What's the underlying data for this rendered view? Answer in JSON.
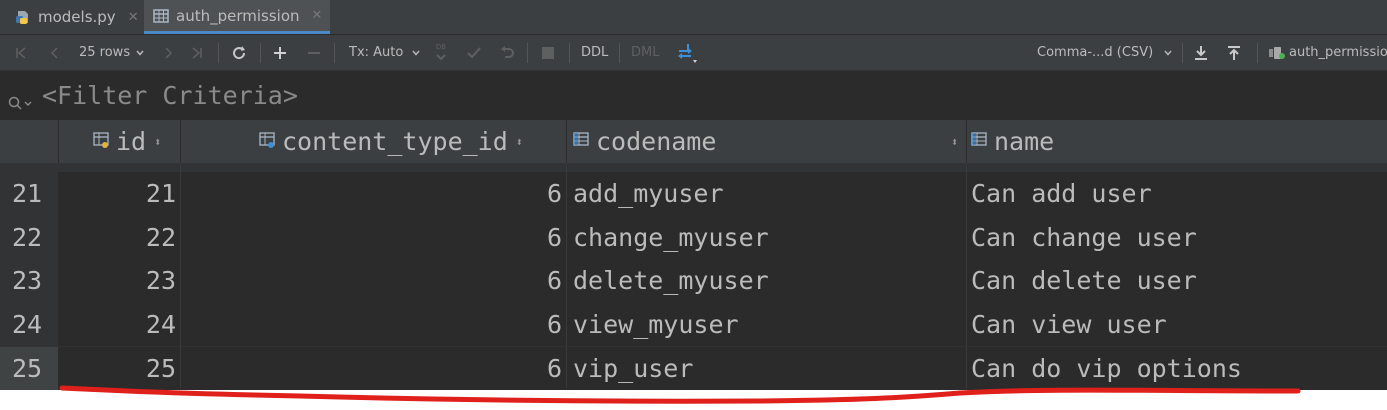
{
  "tabs": [
    {
      "label": "models.py",
      "icon": "python-file-icon",
      "active": false
    },
    {
      "label": "auth_permission",
      "icon": "table-icon",
      "active": true
    }
  ],
  "toolbar": {
    "rows_label": "25 rows",
    "tx_label": "Tx: Auto",
    "ddl_label": "DDL",
    "dml_label": "DML",
    "db_label": "DB",
    "export_format": "Comma-...d (CSV)",
    "table_name": "auth_permission"
  },
  "filter": {
    "placeholder": "<Filter Criteria>"
  },
  "columns": [
    {
      "name": "id",
      "icon": "primary-key-column-icon"
    },
    {
      "name": "content_type_id",
      "icon": "foreign-key-column-icon"
    },
    {
      "name": "codename",
      "icon": "column-icon"
    },
    {
      "name": "name",
      "icon": "column-icon"
    }
  ],
  "rows": [
    {
      "row_number": "21",
      "id": "21",
      "content_type_id": "6",
      "codename": "add_myuser",
      "name": "Can add user"
    },
    {
      "row_number": "22",
      "id": "22",
      "content_type_id": "6",
      "codename": "change_myuser",
      "name": "Can change user"
    },
    {
      "row_number": "23",
      "id": "23",
      "content_type_id": "6",
      "codename": "delete_myuser",
      "name": "Can delete user"
    },
    {
      "row_number": "24",
      "id": "24",
      "content_type_id": "6",
      "codename": "view_myuser",
      "name": "Can view user"
    },
    {
      "row_number": "25",
      "id": "25",
      "content_type_id": "6",
      "codename": "vip_user",
      "name": "Can do vip options"
    }
  ],
  "colors": {
    "background": "#2b2b2b",
    "panel": "#3c3f41",
    "accent": "#4a88c7",
    "annotation_red": "#e0201b"
  }
}
